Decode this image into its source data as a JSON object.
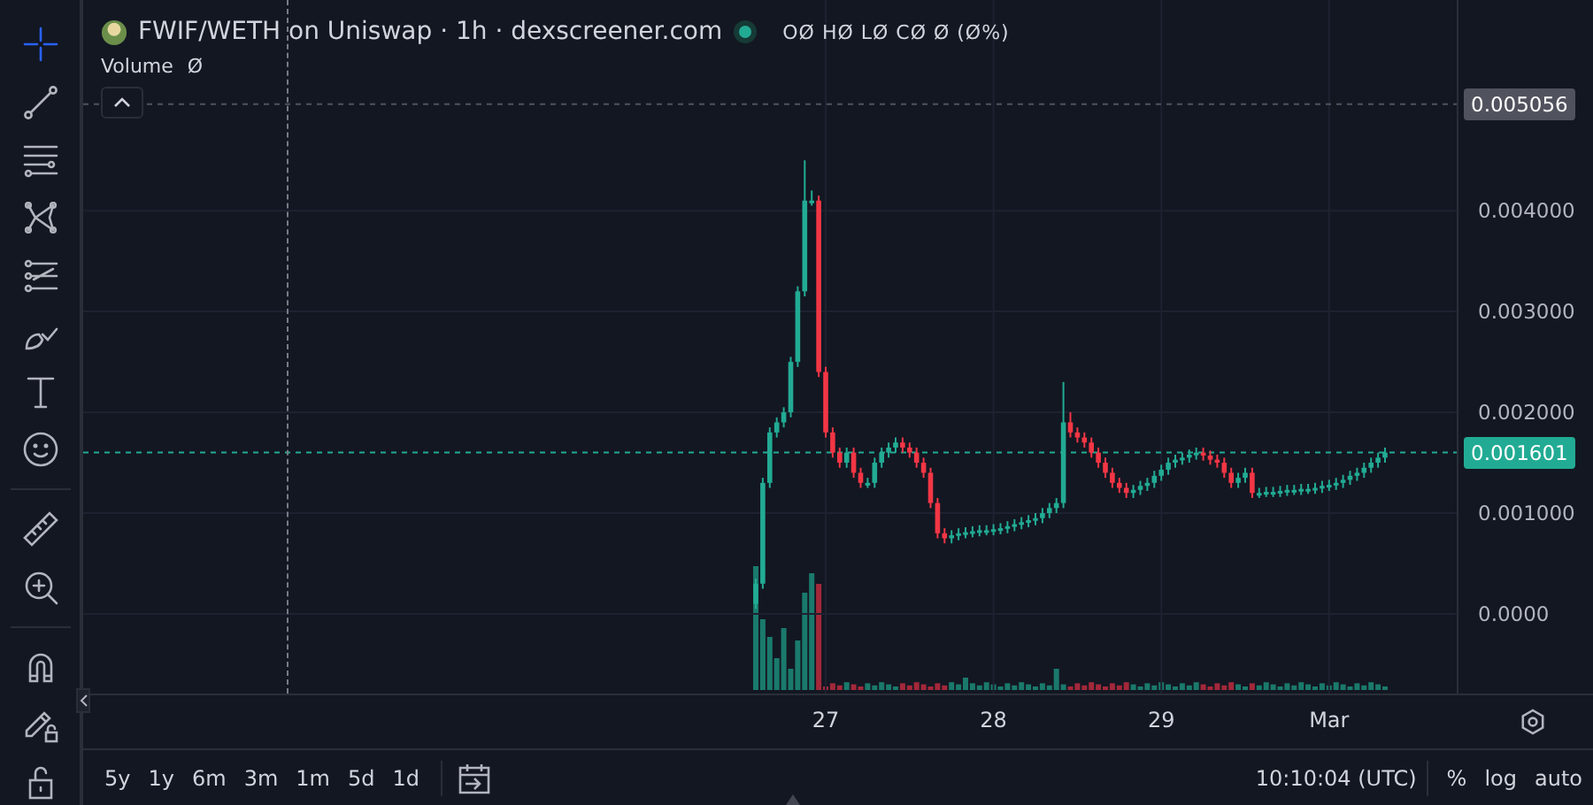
{
  "toolbar": {
    "tools": [
      {
        "kind": "crosshair",
        "selected": true
      },
      {
        "kind": "trend-line",
        "selected": false
      },
      {
        "kind": "fib-lines",
        "selected": false
      },
      {
        "kind": "pattern",
        "selected": false
      },
      {
        "kind": "parallel-lines",
        "selected": false
      },
      {
        "kind": "brush",
        "selected": false
      },
      {
        "kind": "text",
        "selected": false
      },
      {
        "kind": "emoji",
        "selected": false
      },
      {
        "kind": "ruler",
        "selected": false
      },
      {
        "kind": "zoom-in",
        "selected": false
      },
      {
        "kind": "magnet",
        "selected": false
      },
      {
        "kind": "lock-drawings",
        "selected": false
      },
      {
        "kind": "lock",
        "selected": false
      }
    ]
  },
  "chart": {
    "legend": {
      "title": "FWIF/WETH on Uniswap · 1h · dexscreener.com",
      "ohlc": "OØ HØ LØ CØ Ø (Ø%)",
      "volume_label": "Volume",
      "volume_value": "Ø"
    },
    "chart_data": {
      "type": "candlestick",
      "ylim": [
        -0.00079,
        0.00609
      ],
      "grid": true,
      "ref_lines": [
        {
          "axis": "y",
          "value": 0.005056,
          "label": "0.005056",
          "color": "#50535e"
        },
        {
          "axis": "y",
          "value": 0.001601,
          "label": "0.001601",
          "color": "#22ab94"
        }
      ],
      "yticks": [
        {
          "value": 0.004,
          "label": "0.004000"
        },
        {
          "value": 0.003,
          "label": "0.003000"
        },
        {
          "value": 0.002,
          "label": "0.002000"
        },
        {
          "value": 0.001,
          "label": "0.001000"
        },
        {
          "value": 0,
          "label": "0.0000"
        }
      ],
      "categories": [
        null,
        null,
        null,
        null,
        null,
        null,
        null,
        null,
        null,
        null,
        "27",
        null,
        null,
        null,
        null,
        null,
        null,
        null,
        null,
        null,
        null,
        null,
        null,
        null,
        null,
        null,
        null,
        null,
        null,
        null,
        null,
        null,
        null,
        null,
        "28",
        null,
        null,
        null,
        null,
        null,
        null,
        null,
        null,
        null,
        null,
        null,
        null,
        null,
        null,
        null,
        null,
        null,
        null,
        null,
        null,
        null,
        null,
        null,
        "29",
        null,
        null,
        null,
        null,
        null,
        null,
        null,
        null,
        null,
        null,
        null,
        null,
        null,
        null,
        null,
        null,
        null,
        null,
        null,
        null,
        null,
        null,
        null,
        "Mar",
        null,
        null,
        null,
        null,
        null,
        null,
        null,
        null
      ],
      "ohlc": [
        [
          0.0001,
          0.00035,
          5e-05,
          0.0003
        ],
        [
          0.0003,
          0.00135,
          0.00025,
          0.0013
        ],
        [
          0.0013,
          0.00185,
          0.00125,
          0.0018
        ],
        [
          0.0018,
          0.00195,
          0.00175,
          0.0019
        ],
        [
          0.0019,
          0.00205,
          0.00185,
          0.002
        ],
        [
          0.002,
          0.00255,
          0.00195,
          0.0025
        ],
        [
          0.0025,
          0.00325,
          0.00245,
          0.0032
        ],
        [
          0.0032,
          0.0045,
          0.00315,
          0.0041
        ],
        [
          0.0041,
          0.0042,
          0.00405,
          0.0041
        ],
        [
          0.0041,
          0.00415,
          0.00235,
          0.0024
        ],
        [
          0.0024,
          0.00245,
          0.00175,
          0.0018
        ],
        [
          0.0018,
          0.00185,
          0.00155,
          0.0016
        ],
        [
          0.0016,
          0.00165,
          0.00145,
          0.0015
        ],
        [
          0.0015,
          0.00165,
          0.00145,
          0.0016
        ],
        [
          0.0016,
          0.00165,
          0.00135,
          0.0014
        ],
        [
          0.0014,
          0.00145,
          0.00125,
          0.0013
        ],
        [
          0.0013,
          0.00135,
          0.00125,
          0.0013
        ],
        [
          0.0013,
          0.00155,
          0.00125,
          0.0015
        ],
        [
          0.0015,
          0.00165,
          0.00145,
          0.0016
        ],
        [
          0.0016,
          0.0017,
          0.00155,
          0.00165
        ],
        [
          0.00165,
          0.00175,
          0.0016,
          0.0017
        ],
        [
          0.0017,
          0.00175,
          0.0016,
          0.00165
        ],
        [
          0.00165,
          0.0017,
          0.00155,
          0.0016
        ],
        [
          0.0016,
          0.00165,
          0.00145,
          0.0015
        ],
        [
          0.0015,
          0.00155,
          0.00135,
          0.0014
        ],
        [
          0.0014,
          0.00145,
          0.00105,
          0.0011
        ],
        [
          0.0011,
          0.00115,
          0.00075,
          0.0008
        ],
        [
          0.0008,
          0.00085,
          0.0007,
          0.00075
        ],
        [
          0.00075,
          0.00083,
          0.0007,
          0.00078
        ],
        [
          0.00078,
          0.00085,
          0.00073,
          0.0008
        ],
        [
          0.0008,
          0.00086,
          0.00075,
          0.00081
        ],
        [
          0.00081,
          0.00087,
          0.00076,
          0.00082
        ],
        [
          0.00082,
          0.00088,
          0.00077,
          0.00083
        ],
        [
          0.00083,
          0.00088,
          0.00078,
          0.00083
        ],
        [
          0.00083,
          0.00089,
          0.00078,
          0.00084
        ],
        [
          0.00084,
          0.0009,
          0.00079,
          0.00085
        ],
        [
          0.00085,
          0.00092,
          0.0008,
          0.00087
        ],
        [
          0.00087,
          0.00094,
          0.00082,
          0.00089
        ],
        [
          0.00089,
          0.00096,
          0.00084,
          0.00091
        ],
        [
          0.00091,
          0.00098,
          0.00086,
          0.00093
        ],
        [
          0.00093,
          0.001,
          0.00088,
          0.00095
        ],
        [
          0.00095,
          0.00105,
          0.0009,
          0.001
        ],
        [
          0.001,
          0.0011,
          0.00095,
          0.00105
        ],
        [
          0.00105,
          0.00115,
          0.001,
          0.0011
        ],
        [
          0.0011,
          0.0023,
          0.00105,
          0.0019
        ],
        [
          0.0019,
          0.002,
          0.00175,
          0.0018
        ],
        [
          0.0018,
          0.00185,
          0.0017,
          0.00175
        ],
        [
          0.00175,
          0.0018,
          0.00165,
          0.0017
        ],
        [
          0.0017,
          0.00175,
          0.00155,
          0.0016
        ],
        [
          0.0016,
          0.00165,
          0.00145,
          0.0015
        ],
        [
          0.0015,
          0.00155,
          0.00135,
          0.0014
        ],
        [
          0.0014,
          0.00145,
          0.00125,
          0.0013
        ],
        [
          0.0013,
          0.00135,
          0.0012,
          0.00125
        ],
        [
          0.00125,
          0.0013,
          0.00115,
          0.0012
        ],
        [
          0.0012,
          0.00128,
          0.00115,
          0.00123
        ],
        [
          0.00123,
          0.00132,
          0.00118,
          0.00127
        ],
        [
          0.00127,
          0.00135,
          0.00122,
          0.0013
        ],
        [
          0.0013,
          0.00142,
          0.00125,
          0.00137
        ],
        [
          0.00137,
          0.00148,
          0.00132,
          0.00143
        ],
        [
          0.00143,
          0.00155,
          0.00138,
          0.0015
        ],
        [
          0.0015,
          0.00158,
          0.00145,
          0.00153
        ],
        [
          0.00153,
          0.0016,
          0.00148,
          0.00155
        ],
        [
          0.00155,
          0.00163,
          0.0015,
          0.00158
        ],
        [
          0.00158,
          0.00165,
          0.00153,
          0.0016
        ],
        [
          0.0016,
          0.00165,
          0.00152,
          0.00157
        ],
        [
          0.00157,
          0.00162,
          0.00148,
          0.00153
        ],
        [
          0.00153,
          0.00158,
          0.00145,
          0.0015
        ],
        [
          0.0015,
          0.00155,
          0.00135,
          0.0014
        ],
        [
          0.0014,
          0.00145,
          0.00125,
          0.0013
        ],
        [
          0.0013,
          0.0014,
          0.00125,
          0.00135
        ],
        [
          0.00135,
          0.00145,
          0.0013,
          0.0014
        ],
        [
          0.0014,
          0.00145,
          0.00115,
          0.0012
        ],
        [
          0.0012,
          0.00125,
          0.00115,
          0.0012
        ],
        [
          0.0012,
          0.00126,
          0.00116,
          0.00121
        ],
        [
          0.00121,
          0.00126,
          0.00116,
          0.00121
        ],
        [
          0.00121,
          0.00127,
          0.00116,
          0.00122
        ],
        [
          0.00122,
          0.00128,
          0.00117,
          0.00123
        ],
        [
          0.00123,
          0.00128,
          0.00118,
          0.00123
        ],
        [
          0.00123,
          0.00129,
          0.00118,
          0.00124
        ],
        [
          0.00124,
          0.00129,
          0.00119,
          0.00124
        ],
        [
          0.00124,
          0.0013,
          0.00119,
          0.00125
        ],
        [
          0.00125,
          0.00132,
          0.0012,
          0.00127
        ],
        [
          0.00127,
          0.00133,
          0.00122,
          0.00128
        ],
        [
          0.00128,
          0.00135,
          0.00123,
          0.0013
        ],
        [
          0.0013,
          0.00138,
          0.00125,
          0.00133
        ],
        [
          0.00133,
          0.00142,
          0.00128,
          0.00137
        ],
        [
          0.00137,
          0.00145,
          0.00132,
          0.0014
        ],
        [
          0.0014,
          0.0015,
          0.00135,
          0.00145
        ],
        [
          0.00145,
          0.00155,
          0.0014,
          0.0015
        ],
        [
          0.0015,
          0.0016,
          0.00145,
          0.00155
        ],
        [
          0.00155,
          0.00165,
          0.0015,
          0.001601
        ]
      ]
    }
  },
  "bottom_bar": {
    "ranges": [
      "5y",
      "1y",
      "6m",
      "3m",
      "1m",
      "5d",
      "1d"
    ],
    "clock": "10:10:04 (UTC)",
    "scale_options": [
      "%",
      "log",
      "auto"
    ]
  }
}
